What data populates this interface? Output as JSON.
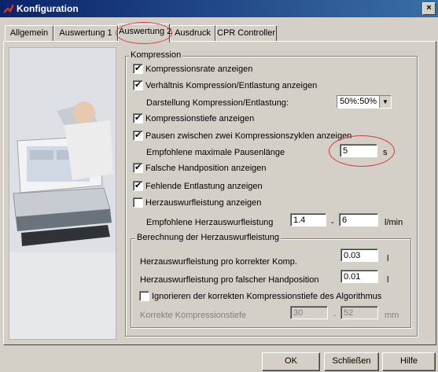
{
  "window": {
    "title": "Konfiguration",
    "close_label": "×"
  },
  "tabs": [
    {
      "label": "Allgemein"
    },
    {
      "label": "Auswertung 1"
    },
    {
      "label": "Auswertung 2"
    },
    {
      "label": "Ausdruck"
    },
    {
      "label": "CPR Controller"
    }
  ],
  "kompression": {
    "title": "Kompression",
    "items": {
      "kompressionsrate": {
        "label": "Kompressionsrate anzeigen",
        "checked": true
      },
      "verhaeltnis": {
        "label": "Verhältnis Kompression/Entlastung anzeigen",
        "checked": true
      },
      "darstellung": {
        "label": "Darstellung Kompression/Entlastung:",
        "value": "50%:50%"
      },
      "kompressionstiefe": {
        "label": "Kompressionstiefe anzeigen",
        "checked": true
      },
      "pausen": {
        "label": "Pausen zwischen zwei Kompressionszyklen anzeigen",
        "checked": true
      },
      "pausenlaenge": {
        "label": "Empfohlene maximale Pausenlänge",
        "value": "5",
        "unit": "s"
      },
      "handposition": {
        "label": "Falsche Handposition anzeigen",
        "checked": true
      },
      "entlastung": {
        "label": "Fehlende Entlastung anzeigen",
        "checked": true
      },
      "herzauswurf": {
        "label": "Herzauswurfleistung anzeigen",
        "checked": false
      },
      "empf_herzauswurf": {
        "label": "Empfohlene Herzauswurfleistung",
        "min": "1.4",
        "dash": "-",
        "max": "6",
        "unit": "l/min"
      }
    }
  },
  "berechnung": {
    "title": "Berechnung der Herzauswurfleistung",
    "pro_korrekter": {
      "label": "Herzauswurfleistung pro korrekter Komp.",
      "value": "0.03",
      "unit": "l"
    },
    "pro_falscher": {
      "label": "Herzauswurfleistung pro falscher Handposition",
      "value": "0.01",
      "unit": "l"
    },
    "ignorieren": {
      "label": "Ignorieren der korrekten Kompressionstiefe des Algorithmus",
      "checked": false
    },
    "korrekte_tiefe": {
      "label": "Korrekte Kompressionstiefe",
      "min": "30",
      "dash": "-",
      "max": "52",
      "unit": "mm"
    }
  },
  "footer": {
    "ok": "OK",
    "schliessen": "Schließen",
    "hilfe": "Hilfe"
  },
  "colors": {
    "title_bar": "#0a246a",
    "face": "#d4d0c8",
    "highlight_ring": "#d43a3a"
  }
}
